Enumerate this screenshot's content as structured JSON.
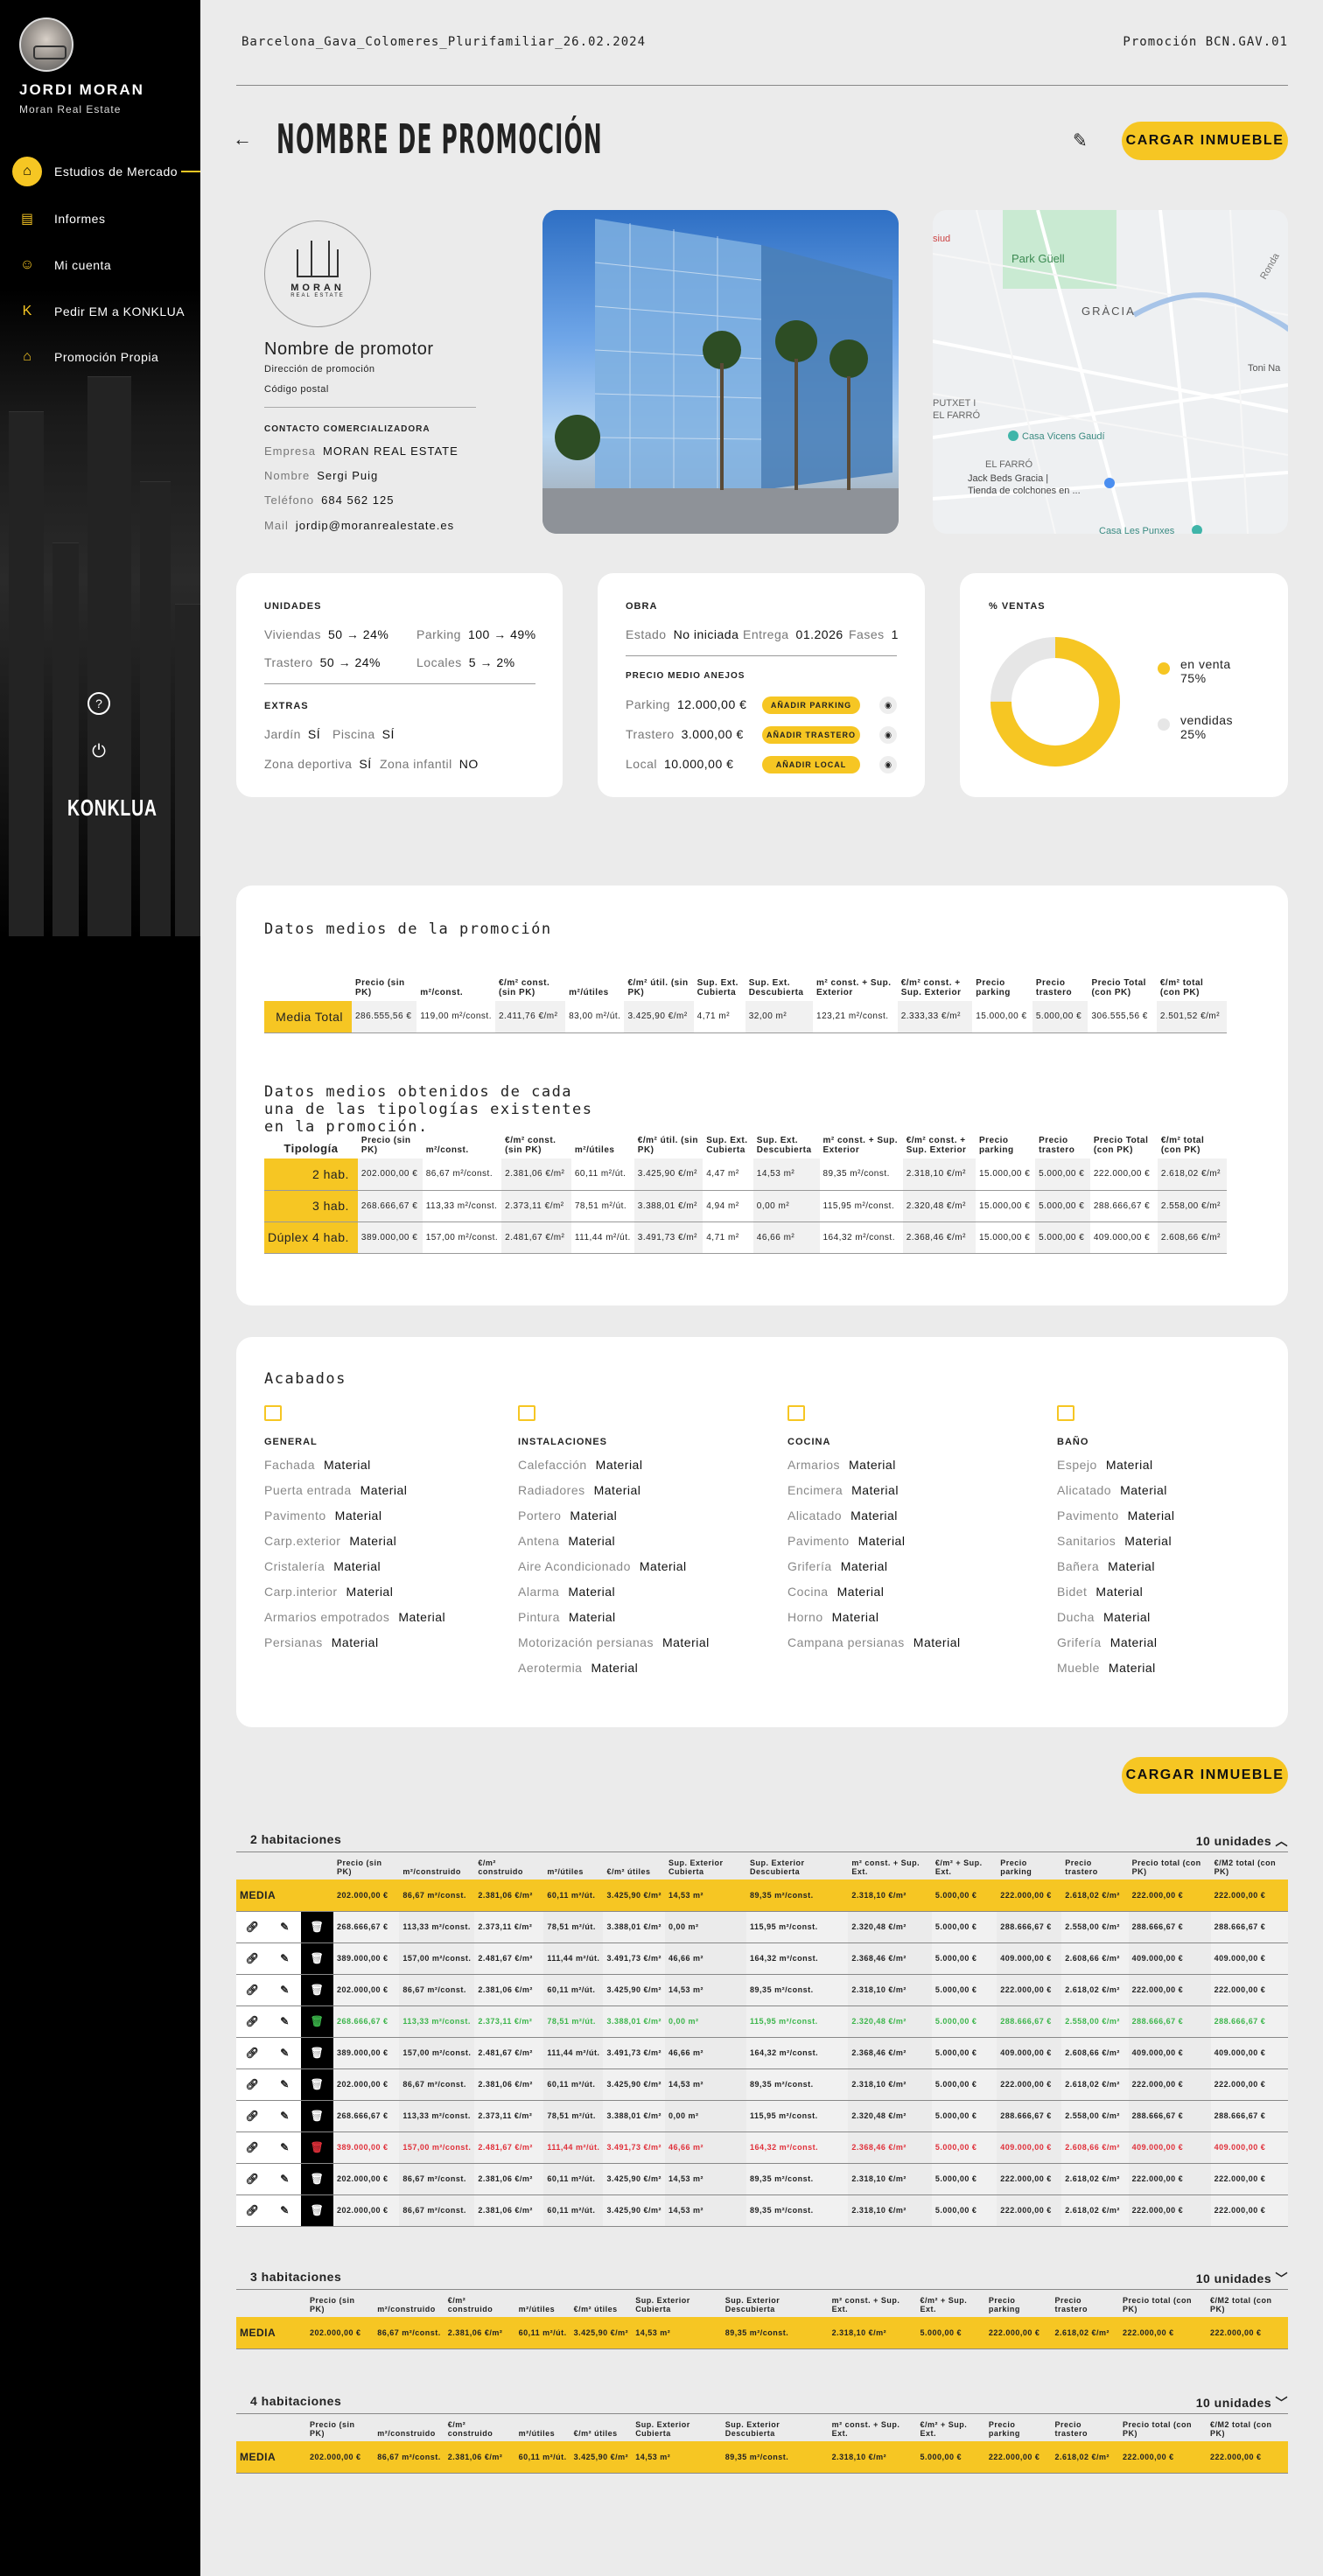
{
  "user": {
    "name": "JORDI MORAN",
    "company": "Moran Real Estate"
  },
  "nav": [
    {
      "label": "Estudios de Mercado",
      "icon": "house-dollar-icon",
      "active": true
    },
    {
      "label": "Informes",
      "icon": "document-icon"
    },
    {
      "label": "Mi cuenta",
      "icon": "user-icon"
    },
    {
      "label": "Pedir EM a KONKLUA",
      "icon": "k-letter-icon"
    },
    {
      "label": "Promoción Propia",
      "icon": "house-icon"
    }
  ],
  "sidebar": {
    "help_icon": "?",
    "power_icon": "⏻",
    "logo": "KONKLUA"
  },
  "header": {
    "breadcrumb": "Barcelona_Gava_Colomeres_Plurifamiliar_26.02.2024",
    "promo_code": "Promoción BCN.GAV.01",
    "title": "NOMBRE DE PROMOCIÓN",
    "upload_button": "CARGAR INMUEBLE"
  },
  "promoter": {
    "logo_main": "MORAN",
    "logo_sub": "REAL ESTATE",
    "name": "Nombre de promotor",
    "address": "Dirección de promoción",
    "postal": "Código postal",
    "contact_title": "CONTACTO COMERCIALIZADORA",
    "contact": [
      {
        "k": "Empresa",
        "v": "MORAN REAL ESTATE"
      },
      {
        "k": "Nombre",
        "v": "Sergi Puig"
      },
      {
        "k": "Teléfono",
        "v": "684 562 125"
      },
      {
        "k": "Mail",
        "v": "jordip@moranrealestate.es"
      }
    ]
  },
  "map": {
    "labels": [
      "Park Güell",
      "GRÀCIA",
      "PUTXET I EL FARRÓ",
      "EL FARRÓ",
      "Casa Vicens Gaudí",
      "Jack Beds Gracia | Tienda de colchones en ...",
      "Casa Les Punxes",
      "Toni Na",
      "siud",
      "Ronda"
    ]
  },
  "unidades": {
    "title": "UNIDADES",
    "rows": [
      [
        {
          "k": "Viviendas",
          "v": "50 → 24%"
        },
        {
          "k": "Parking",
          "v": "100 → 49%"
        }
      ],
      [
        {
          "k": "Trastero",
          "v": "50 → 24%"
        },
        {
          "k": "Locales",
          "v": "5 → 2%"
        }
      ]
    ],
    "extras_title": "EXTRAS",
    "extras": [
      [
        {
          "k": "Jardín",
          "v": "SÍ"
        },
        {
          "k": "Piscina",
          "v": "SÍ"
        }
      ],
      [
        {
          "k": "Zona deportiva",
          "v": "SÍ"
        },
        {
          "k": "Zona infantil",
          "v": "NO"
        }
      ]
    ]
  },
  "obra": {
    "title": "OBRA",
    "estado_k": "Estado",
    "estado_v": "No iniciada",
    "entrega_k": "Entrega",
    "entrega_v": "01.2026",
    "fases_k": "Fases",
    "fases_v": "1",
    "precio_title": "PRECIO MEDIO ANEJOS",
    "anejos": [
      {
        "k": "Parking",
        "v": "12.000,00 €",
        "btn": "AÑADIR PARKING"
      },
      {
        "k": "Trastero",
        "v": "3.000,00 €",
        "btn": "AÑADIR TRASTERO"
      },
      {
        "k": "Local",
        "v": "10.000,00 €",
        "btn": "AÑADIR LOCAL"
      }
    ]
  },
  "ventas": {
    "title": "% VENTAS",
    "legend": [
      {
        "label": "en venta",
        "pct": "75%",
        "color": "#f6c623"
      },
      {
        "label": "vendidas",
        "pct": "25%",
        "color": "#e6e6e6"
      }
    ],
    "chart": {
      "en_venta": 0.75
    }
  },
  "datos": {
    "title": "Datos medios de la promoción",
    "headers": [
      "Precio (sin PK)",
      "m²/const.",
      "€/m² const. (sin PK)",
      "m²/útiles",
      "€/m² útil. (sin PK)",
      "Sup. Ext. Cubierta",
      "Sup. Ext. Descubierta",
      "m² const. + Sup. Exterior",
      "€/m² const. + Sup. Exterior",
      "Precio parking",
      "Precio trastero",
      "Precio Total (con PK)",
      "€/m² total (con PK)"
    ],
    "media": {
      "label": "Media Total",
      "values": [
        "286.555,56 €",
        "119,00 m²/const.",
        "2.411,76 €/m²",
        "83,00 m²/út.",
        "3.425,90 €/m²",
        "4,71 m²",
        "32,00 m²",
        "123,21 m²/const.",
        "2.333,33 €/m²",
        "15.000,00 €",
        "5.000,00 €",
        "306.555,56 €",
        "2.501,52 €/m²"
      ]
    },
    "tipos_title": "Datos medios obtenidos de cada una de las tipologías existentes en la promoción.",
    "tipos_label": "Tipología",
    "tipos": [
      {
        "label": "2 hab.",
        "values": [
          "202.000,00 €",
          "86,67 m²/const.",
          "2.381,06 €/m²",
          "60,11 m²/út.",
          "3.425,90 €/m²",
          "4,47 m²",
          "14,53 m²",
          "89,35 m²/const.",
          "2.318,10 €/m²",
          "15.000,00 €",
          "5.000,00 €",
          "222.000,00 €",
          "2.618,02 €/m²"
        ]
      },
      {
        "label": "3 hab.",
        "values": [
          "268.666,67 €",
          "113,33 m²/const.",
          "2.373,11 €/m²",
          "78,51 m²/út.",
          "3.388,01 €/m²",
          "4,94 m²",
          "0,00 m²",
          "115,95 m²/const.",
          "2.320,48 €/m²",
          "15.000,00 €",
          "5.000,00 €",
          "288.666,67 €",
          "2.558,00 €/m²"
        ]
      },
      {
        "label": "Dúplex 4 hab.",
        "values": [
          "389.000,00 €",
          "157,00 m²/const.",
          "2.481,67 €/m²",
          "111,44 m²/út.",
          "3.491,73 €/m²",
          "4,71 m²",
          "46,66 m²",
          "164,32 m²/const.",
          "2.368,46 €/m²",
          "15.000,00 €",
          "5.000,00 €",
          "409.000,00 €",
          "2.608,66 €/m²"
        ]
      }
    ]
  },
  "acabados": {
    "title": "Acabados",
    "cols": [
      {
        "title": "GENERAL",
        "icon": "building-icon",
        "items": [
          [
            "Fachada",
            "Material"
          ],
          [
            "Puerta entrada",
            "Material"
          ],
          [
            "Pavimento",
            "Material"
          ],
          [
            "Carp.exterior",
            "Material"
          ],
          [
            "Cristalería",
            "Material"
          ],
          [
            "Carp.interior",
            "Material"
          ],
          [
            "Armarios empotrados",
            "Material"
          ],
          [
            "Persianas",
            "Material"
          ]
        ]
      },
      {
        "title": "INSTALACIONES",
        "icon": "wrench-icon",
        "items": [
          [
            "Calefacción",
            "Material"
          ],
          [
            "Radiadores",
            "Material"
          ],
          [
            "Portero",
            "Material"
          ],
          [
            "Antena",
            "Material"
          ],
          [
            "Aire Acondicionado",
            "Material"
          ],
          [
            "Alarma",
            "Material"
          ],
          [
            "Pintura",
            "Material"
          ],
          [
            "Motorización persianas",
            "Material"
          ],
          [
            "Aerotermia",
            "Material"
          ]
        ]
      },
      {
        "title": "COCINA",
        "icon": "oven-icon",
        "items": [
          [
            "Armarios",
            "Material"
          ],
          [
            "Encimera",
            "Material"
          ],
          [
            "Alicatado",
            "Material"
          ],
          [
            "Pavimento",
            "Material"
          ],
          [
            "Grifería",
            "Material"
          ],
          [
            "Cocina",
            "Material"
          ],
          [
            "Horno",
            "Material"
          ],
          [
            "Campana persianas",
            "Material"
          ]
        ]
      },
      {
        "title": "BAÑO",
        "icon": "bath-icon",
        "items": [
          [
            "Espejo",
            "Material"
          ],
          [
            "Alicatado",
            "Material"
          ],
          [
            "Pavimento",
            "Material"
          ],
          [
            "Sanitarios",
            "Material"
          ],
          [
            "Bañera",
            "Material"
          ],
          [
            "Bidet",
            "Material"
          ],
          [
            "Ducha",
            "Material"
          ],
          [
            "Grifería",
            "Material"
          ],
          [
            "Mueble",
            "Material"
          ]
        ]
      }
    ]
  },
  "units": {
    "upload_button": "CARGAR INMUEBLE",
    "headers": [
      "Precio (sin PK)",
      "m²/construido",
      "€/m² construido",
      "m²/útiles",
      "€/m² útiles",
      "Sup. Exterior Cubierta",
      "Sup. Exterior Descubierta",
      "m² const. + Sup. Ext.",
      "€/m² + Sup. Ext.",
      "Precio parking",
      "Precio trastero",
      "Precio total (con PK)",
      "€/M2 total (con PK)"
    ],
    "groups": [
      {
        "title": "2 habitaciones",
        "count": "10 unidades",
        "open": true,
        "media": [
          "MEDIA",
          "202.000,00 €",
          "86,67 m²/const.",
          "2.381,06 €/m²",
          "60,11 m²/út.",
          "3.425,90 €/m²",
          "14,53 m²",
          "89,35 m²/const.",
          "2.318,10 €/m²",
          "5.000,00 €",
          "222.000,00 €",
          "2.618,02 €/m²",
          "222.000,00 €",
          "222.000,00 €"
        ],
        "rows": [
          {
            "s": "",
            "v": [
              "268.666,67 €",
              "113,33 m²/const.",
              "2.373,11 €/m²",
              "78,51 m²/út.",
              "3.388,01 €/m²",
              "0,00 m²",
              "115,95 m²/const.",
              "2.320,48 €/m²",
              "5.000,00 €",
              "288.666,67 €",
              "2.558,00 €/m²",
              "288.666,67 €",
              "288.666,67 €"
            ]
          },
          {
            "s": "",
            "v": [
              "389.000,00 €",
              "157,00 m²/const.",
              "2.481,67 €/m²",
              "111,44 m²/út.",
              "3.491,73 €/m²",
              "46,66 m²",
              "164,32 m²/const.",
              "2.368,46 €/m²",
              "5.000,00 €",
              "409.000,00 €",
              "2.608,66 €/m²",
              "409.000,00 €",
              "409.000,00 €"
            ]
          },
          {
            "s": "",
            "v": [
              "202.000,00 €",
              "86,67 m²/const.",
              "2.381,06 €/m²",
              "60,11 m²/út.",
              "3.425,90 €/m²",
              "14,53 m²",
              "89,35 m²/const.",
              "2.318,10 €/m²",
              "5.000,00 €",
              "222.000,00 €",
              "2.618,02 €/m²",
              "222.000,00 €",
              "222.000,00 €"
            ]
          },
          {
            "s": "green",
            "v": [
              "268.666,67 €",
              "113,33 m²/const.",
              "2.373,11 €/m²",
              "78,51 m²/út.",
              "3.388,01 €/m²",
              "0,00 m²",
              "115,95 m²/const.",
              "2.320,48 €/m²",
              "5.000,00 €",
              "288.666,67 €",
              "2.558,00 €/m²",
              "288.666,67 €",
              "288.666,67 €"
            ]
          },
          {
            "s": "",
            "v": [
              "389.000,00 €",
              "157,00 m²/const.",
              "2.481,67 €/m²",
              "111,44 m²/út.",
              "3.491,73 €/m²",
              "46,66 m²",
              "164,32 m²/const.",
              "2.368,46 €/m²",
              "5.000,00 €",
              "409.000,00 €",
              "2.608,66 €/m²",
              "409.000,00 €",
              "409.000,00 €"
            ]
          },
          {
            "s": "",
            "v": [
              "202.000,00 €",
              "86,67 m²/const.",
              "2.381,06 €/m²",
              "60,11 m²/út.",
              "3.425,90 €/m²",
              "14,53 m²",
              "89,35 m²/const.",
              "2.318,10 €/m²",
              "5.000,00 €",
              "222.000,00 €",
              "2.618,02 €/m²",
              "222.000,00 €",
              "222.000,00 €"
            ]
          },
          {
            "s": "",
            "v": [
              "268.666,67 €",
              "113,33 m²/const.",
              "2.373,11 €/m²",
              "78,51 m²/út.",
              "3.388,01 €/m²",
              "0,00 m²",
              "115,95 m²/const.",
              "2.320,48 €/m²",
              "5.000,00 €",
              "288.666,67 €",
              "2.558,00 €/m²",
              "288.666,67 €",
              "288.666,67 €"
            ]
          },
          {
            "s": "red",
            "v": [
              "389.000,00 €",
              "157,00 m²/const.",
              "2.481,67 €/m²",
              "111,44 m²/út.",
              "3.491,73 €/m²",
              "46,66 m²",
              "164,32 m²/const.",
              "2.368,46 €/m²",
              "5.000,00 €",
              "409.000,00 €",
              "2.608,66 €/m²",
              "409.000,00 €",
              "409.000,00 €"
            ]
          },
          {
            "s": "",
            "v": [
              "202.000,00 €",
              "86,67 m²/const.",
              "2.381,06 €/m²",
              "60,11 m²/út.",
              "3.425,90 €/m²",
              "14,53 m²",
              "89,35 m²/const.",
              "2.318,10 €/m²",
              "5.000,00 €",
              "222.000,00 €",
              "2.618,02 €/m²",
              "222.000,00 €",
              "222.000,00 €"
            ]
          },
          {
            "s": "",
            "v": [
              "202.000,00 €",
              "86,67 m²/const.",
              "2.381,06 €/m²",
              "60,11 m²/út.",
              "3.425,90 €/m²",
              "14,53 m²",
              "89,35 m²/const.",
              "2.318,10 €/m²",
              "5.000,00 €",
              "222.000,00 €",
              "2.618,02 €/m²",
              "222.000,00 €",
              "222.000,00 €"
            ]
          }
        ]
      },
      {
        "title": "3 habitaciones",
        "count": "10 unidades",
        "open": false,
        "media": [
          "MEDIA",
          "202.000,00 €",
          "86,67 m²/const.",
          "2.381,06 €/m²",
          "60,11 m²/út.",
          "3.425,90 €/m²",
          "14,53 m²",
          "89,35 m²/const.",
          "2.318,10 €/m²",
          "5.000,00 €",
          "222.000,00 €",
          "2.618,02 €/m²",
          "222.000,00 €",
          "222.000,00 €"
        ]
      },
      {
        "title": "4 habitaciones",
        "count": "10 unidades",
        "open": false,
        "media": [
          "MEDIA",
          "202.000,00 €",
          "86,67 m²/const.",
          "2.381,06 €/m²",
          "60,11 m²/út.",
          "3.425,90 €/m²",
          "14,53 m²",
          "89,35 m²/const.",
          "2.318,10 €/m²",
          "5.000,00 €",
          "222.000,00 €",
          "2.618,02 €/m²",
          "222.000,00 €",
          "222.000,00 €"
        ]
      }
    ]
  },
  "colors": {
    "accent": "#f6c623",
    "sidebar": "#000000",
    "bg": "#ebebeb",
    "green": "#3bb54a",
    "red": "#e0303a"
  }
}
